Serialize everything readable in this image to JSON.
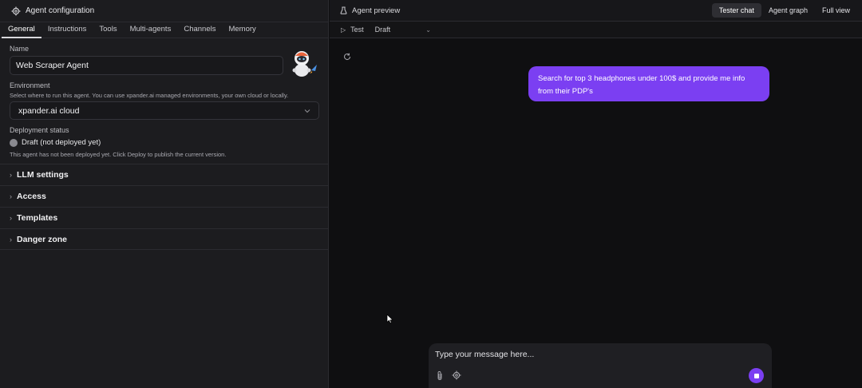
{
  "config_panel": {
    "title": "Agent configuration",
    "tabs": [
      {
        "label": "General",
        "active": true
      },
      {
        "label": "Instructions",
        "active": false
      },
      {
        "label": "Tools",
        "active": false
      },
      {
        "label": "Multi-agents",
        "active": false
      },
      {
        "label": "Channels",
        "active": false
      },
      {
        "label": "Memory",
        "active": false
      }
    ],
    "name_label": "Name",
    "name_value": "Web Scraper Agent",
    "environment_label": "Environment",
    "environment_help": "Select where to run this agent. You can use xpander.ai managed environments, your own cloud or locally.",
    "environment_value": "xpander.ai cloud",
    "deployment_label": "Deployment status",
    "deployment_value": "Draft (not deployed yet)",
    "deployment_help": "This agent has not been deployed yet. Click Deploy to publish the current version.",
    "sections": [
      "LLM settings",
      "Access",
      "Templates",
      "Danger zone"
    ]
  },
  "preview_panel": {
    "title": "Agent preview",
    "view_tabs": [
      {
        "label": "Tester chat",
        "active": true
      },
      {
        "label": "Agent graph",
        "active": false
      },
      {
        "label": "Full view",
        "active": false
      }
    ],
    "test_label": "Test",
    "version_value": "Draft",
    "user_message": "Search for top 3 headphones under 100$ and provide me info from their PDP's",
    "composer_placeholder": "Type your message here..."
  },
  "colors": {
    "accent": "#7b3ff2",
    "panel_bg": "#1c1c1f",
    "preview_bg": "#0f0f11"
  },
  "icons": [
    "gear-icon",
    "robot-avatar-icon",
    "chevron-down-icon",
    "chevron-right-icon",
    "flask-icon",
    "play-icon",
    "refresh-icon",
    "paperclip-icon",
    "settings-icon",
    "stop-icon",
    "mouse-cursor-icon"
  ]
}
